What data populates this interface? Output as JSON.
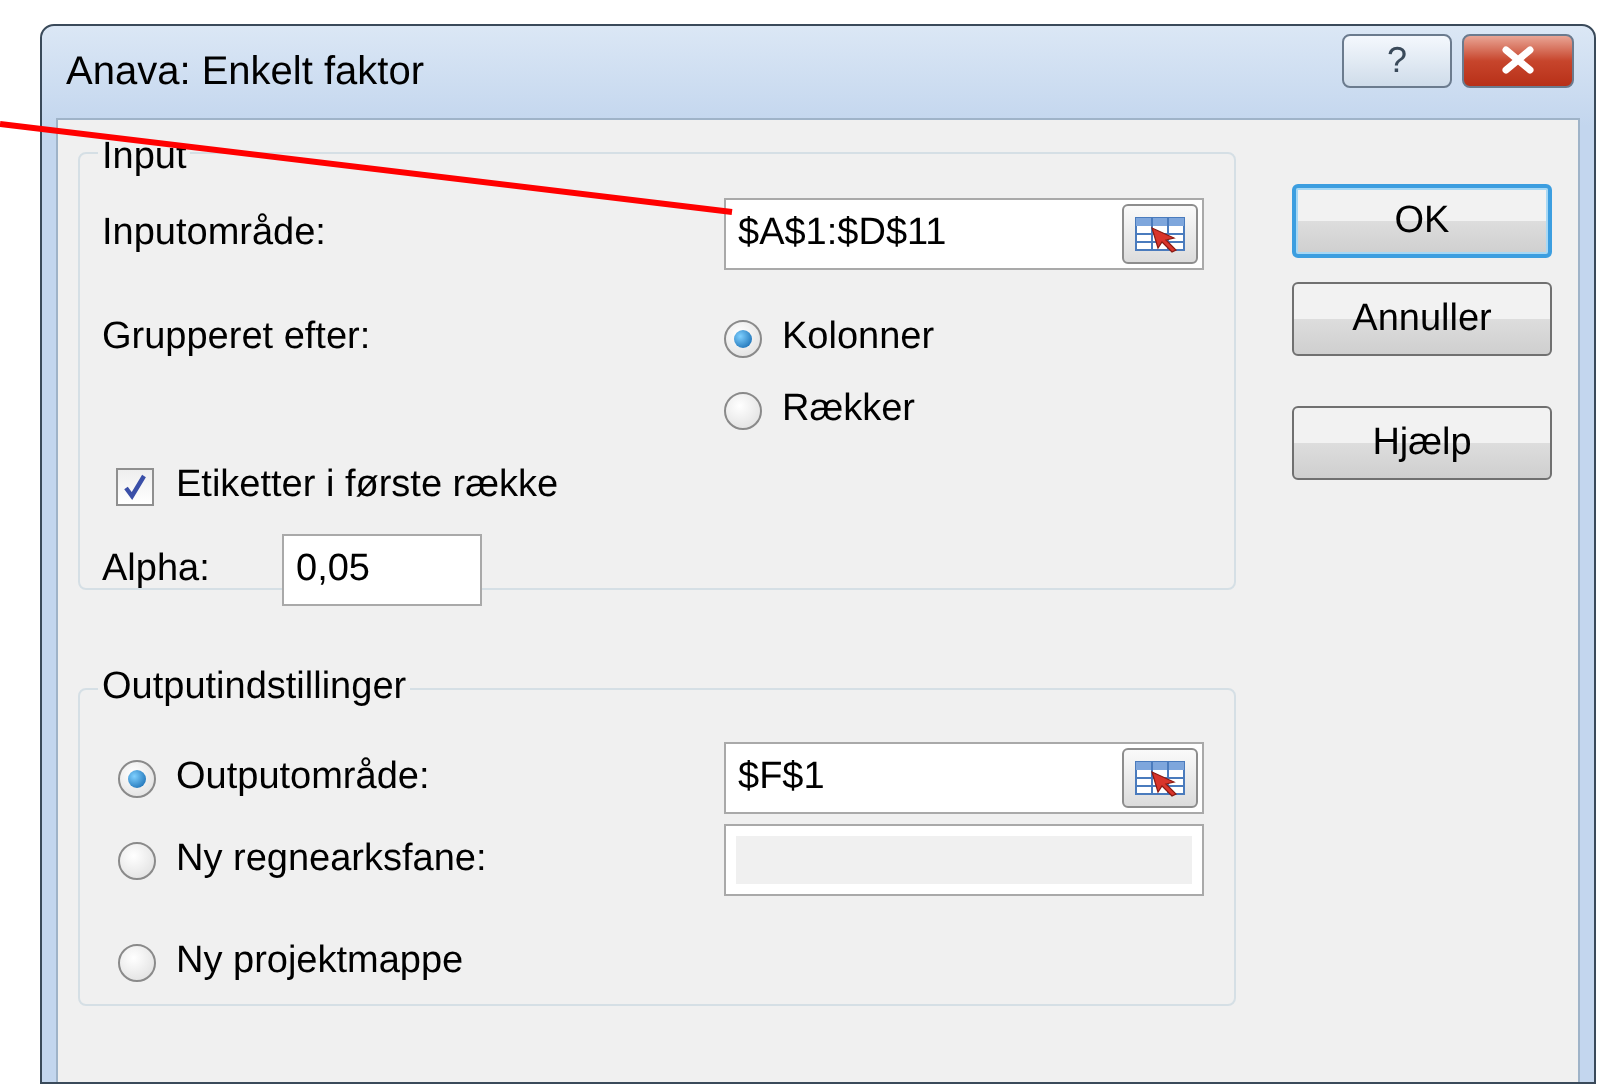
{
  "window": {
    "title": "Anava: Enkelt faktor",
    "title_buttons": [
      {
        "kind": "help",
        "label": "?"
      },
      {
        "kind": "close"
      }
    ]
  },
  "input": {
    "legend": "Input",
    "range": {
      "label": "Inputområde:",
      "value": "$A$1:$D$11"
    },
    "grouped_by": {
      "label": "Grupperet efter:",
      "options": [
        {
          "label": "Kolonner",
          "selected": true
        },
        {
          "label": "Rækker",
          "selected": false
        }
      ]
    },
    "labels_in_first_row": {
      "label": "Etiketter i første række",
      "checked": true
    },
    "alpha": {
      "label": "Alpha:",
      "value": "0,05"
    }
  },
  "output": {
    "legend": "Outputindstillinger",
    "options": [
      {
        "label": "Outputområde:",
        "selected": true,
        "field": {
          "value": "$F$1",
          "disabled": false
        }
      },
      {
        "label": "Ny regnearksfane:",
        "selected": false,
        "field": {
          "disabled": true
        }
      },
      {
        "label": "Ny projektmappe",
        "selected": false
      }
    ]
  },
  "buttons": [
    {
      "label": "OK",
      "default": true
    },
    {
      "label": "Annuller",
      "default": false
    },
    {
      "label": "Hjælp",
      "default": false
    }
  ]
}
